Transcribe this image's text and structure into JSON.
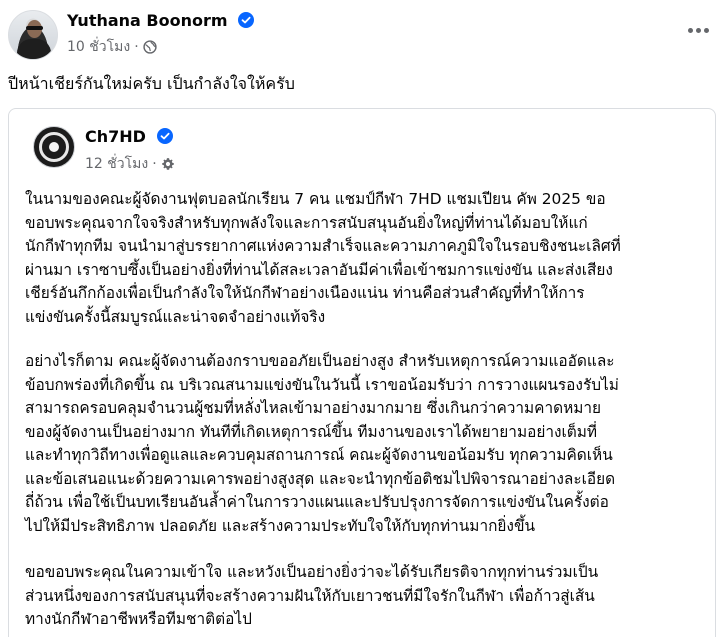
{
  "post": {
    "author": "Yuthana Boonorm",
    "time": "10 ชั่วโมง",
    "separator": "·",
    "audience_icon": "globe-icon",
    "caption": "ปีหน้าเชียร์กันใหม่ครับ เป็นกำลังใจให้ครับ"
  },
  "shared": {
    "author": "Ch7HD",
    "time": "12 ชั่วโมง",
    "separator": "·",
    "audience_icon": "settings-icon",
    "paragraphs": [
      [
        "ในนามของคณะผู้จัดงานฟุตบอลนักเรียน 7 คน แชมป์กีฬา 7HD แชมเปียน คัพ 2025 ขอ",
        "ขอบพระคุณจากใจจริงสำหรับทุกพลังใจและการสนับสนุนอันยิ่งใหญ่ที่ท่านได้มอบให้แก่",
        "นักกีฬาทุกทีม จนนำมาสู่บรรยากาศแห่งความสำเร็จและความภาคภูมิใจในรอบชิงชนะเลิศที่",
        "ผ่านมา เราซาบซึ้งเป็นอย่างยิ่งที่ท่านได้สละเวลาอันมีค่าเพื่อเข้าชมการแข่งขัน และส่งเสียง",
        "เชียร์อันกึกก้องเพื่อเป็นกำลังใจให้นักกีฬาอย่างเนืองแน่น ท่านคือส่วนสำคัญที่ทำให้การ",
        "แข่งขันครั้งนี้สมบูรณ์และน่าจดจำอย่างแท้จริง"
      ],
      [
        "อย่างไรก็ตาม คณะผู้จัดงานต้องกราบขออภัยเป็นอย่างสูง สำหรับเหตุการณ์ความแออัดและ",
        "ข้อบกพร่องที่เกิดขึ้น ณ บริเวณสนามแข่งขันในวันนี้ เราขอน้อมรับว่า การวางแผนรองรับไม่",
        "สามารถครอบคลุมจำนวนผู้ชมที่หลั่งไหลเข้ามาอย่างมากมาย ซึ่งเกินกว่าความคาดหมาย",
        "ของผู้จัดงานเป็นอย่างมาก ทันทีที่เกิดเหตุการณ์ขึ้น ทีมงานของเราได้พยายามอย่างเต็มที่",
        "และทำทุกวิถีทางเพื่อดูแลและควบคุมสถานการณ์ คณะผู้จัดงานขอน้อมรับ ทุกความคิดเห็น",
        "และข้อเสนอแนะด้วยความเคารพอย่างสูงสุด และจะนำทุกข้อติชมไปพิจารณาอย่างละเอียด",
        "ถี่ถ้วน เพื่อใช้เป็นบทเรียนอันล้ำค่าในการวางแผนและปรับปรุงการจัดการแข่งขันในครั้งต่อ",
        "ไปให้มีประสิทธิภาพ ปลอดภัย และสร้างความประทับใจให้กับทุกท่านมากยิ่งขึ้น"
      ],
      [
        "ขอขอบพระคุณในความเข้าใจ และหวังเป็นอย่างยิ่งว่าจะได้รับเกียรติจากทุกท่านร่วมเป็น",
        "ส่วนหนึ่งของการสนับสนุนที่จะสร้างความฝันให้กับเยาวชนที่มีใจรักในกีฬา เพื่อก้าวสู่เส้น",
        "ทางนักกีฬาอาชีพหรือทีมชาติต่อไป"
      ]
    ]
  },
  "colors": {
    "verified": "#0866ff",
    "meta": "#65676b",
    "text": "#050505",
    "border": "#dadde1"
  }
}
